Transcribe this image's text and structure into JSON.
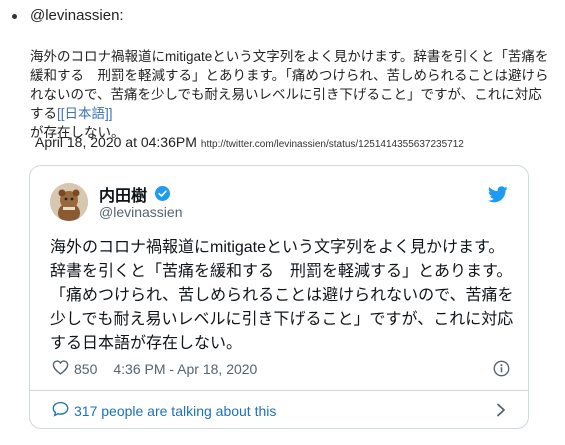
{
  "post": {
    "handle": "@levinassien:",
    "text": "海外のコロナ禍報道にmitigateという文字列をよく見かけます。辞書を引くと「苦痛を緩和する　刑罰を軽減する」とあります。「痛めつけられ、苦しめられることは避けられないので、苦痛を少しでも耐え易いレベルに引き下げること」ですが、これに対応する",
    "link": "[[日本語]]",
    "text_after": "が存在しない。",
    "timestamp": "April 18, 2020 at 04:36PM",
    "url": "http://twitter.com/levinassien/status/1251414355637235712"
  },
  "tweet": {
    "name": "内田樹",
    "screen_name": "@levinassien",
    "body": "海外のコロナ禍報道にmitigateという文字列をよく見かけます。辞書を引くと「苦痛を緩和する　刑罰を軽減する」とあります。「痛めつけられ、苦しめられることは避けられないので、苦痛を少しでも耐え易いレベルに引き下げること」ですが、これに対応する日本語が存在しない。",
    "likes": "850",
    "time": "4:36 PM - Apr 18, 2020",
    "talking": "317 people are talking about this"
  },
  "icons": {
    "verified": "verified-badge-icon",
    "bird": "twitter-bird-icon",
    "heart": "heart-icon",
    "info": "info-icon",
    "bubble": "speech-bubble-icon",
    "chevron": "chevron-right-icon"
  },
  "colors": {
    "twitter_blue": "#1d9bf0",
    "link": "#3b73b9"
  }
}
